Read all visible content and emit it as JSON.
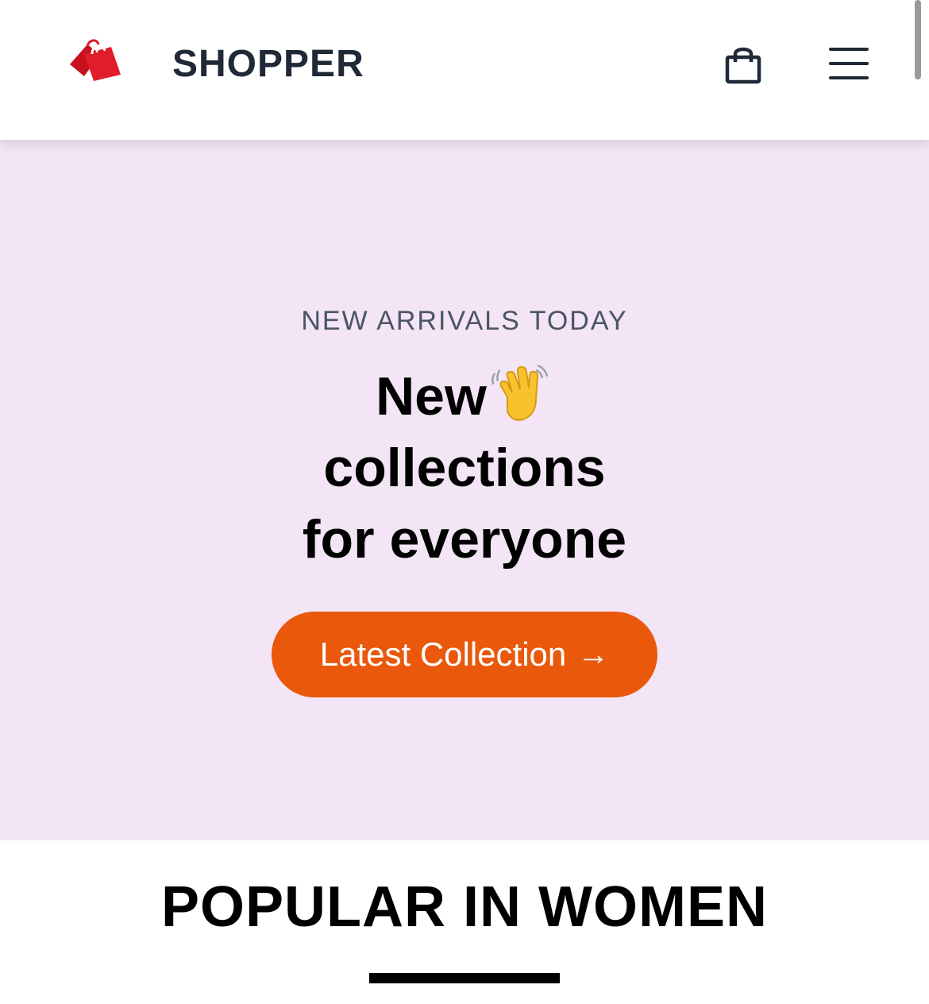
{
  "header": {
    "brand_name": "SHOPPER",
    "logo_icon": "shopping-bag-logo",
    "cart_icon": "shopping-bag-icon",
    "menu_icon": "hamburger-menu-icon"
  },
  "hero": {
    "kicker": "NEW ARRIVALS TODAY",
    "title_line1": "New",
    "title_emoji": "waving-hand-icon",
    "title_line2": "collections",
    "title_line3": "for everyone",
    "cta_label": "Latest Collection",
    "cta_arrow": "→",
    "background_color": "#f3e5f5",
    "cta_color": "#ea580c"
  },
  "popular": {
    "title": "POPULAR IN WOMEN"
  },
  "colors": {
    "brand_red": "#e11d2a",
    "text_dark": "#1f2937",
    "kicker_gray": "#4b5563"
  }
}
